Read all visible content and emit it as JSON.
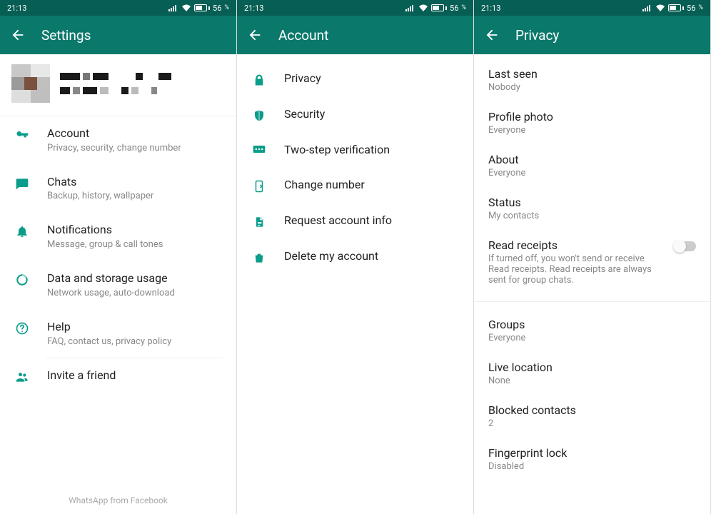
{
  "status": {
    "time": "21:13",
    "battery": "56",
    "battery_suffix": "%"
  },
  "panel1": {
    "title": "Settings",
    "items": [
      {
        "title": "Account",
        "sub": "Privacy, security, change number"
      },
      {
        "title": "Chats",
        "sub": "Backup, history, wallpaper"
      },
      {
        "title": "Notifications",
        "sub": "Message, group & call tones"
      },
      {
        "title": "Data and storage usage",
        "sub": "Network usage, auto-download"
      },
      {
        "title": "Help",
        "sub": "FAQ, contact us, privacy policy"
      },
      {
        "title": "Invite a friend",
        "sub": ""
      }
    ],
    "footer": "WhatsApp from Facebook"
  },
  "panel2": {
    "title": "Account",
    "items": [
      {
        "title": "Privacy"
      },
      {
        "title": "Security"
      },
      {
        "title": "Two-step verification"
      },
      {
        "title": "Change number"
      },
      {
        "title": "Request account info"
      },
      {
        "title": "Delete my account"
      }
    ]
  },
  "panel3": {
    "title": "Privacy",
    "items_a": [
      {
        "title": "Last seen",
        "sub": "Nobody"
      },
      {
        "title": "Profile photo",
        "sub": "Everyone"
      },
      {
        "title": "About",
        "sub": "Everyone"
      },
      {
        "title": "Status",
        "sub": "My contacts"
      }
    ],
    "read_receipts": {
      "title": "Read receipts",
      "sub": "If turned off, you won't send or receive Read receipts. Read receipts are always sent for group chats."
    },
    "items_b": [
      {
        "title": "Groups",
        "sub": "Everyone"
      },
      {
        "title": "Live location",
        "sub": "None"
      },
      {
        "title": "Blocked contacts",
        "sub": "2"
      },
      {
        "title": "Fingerprint lock",
        "sub": "Disabled"
      }
    ]
  }
}
